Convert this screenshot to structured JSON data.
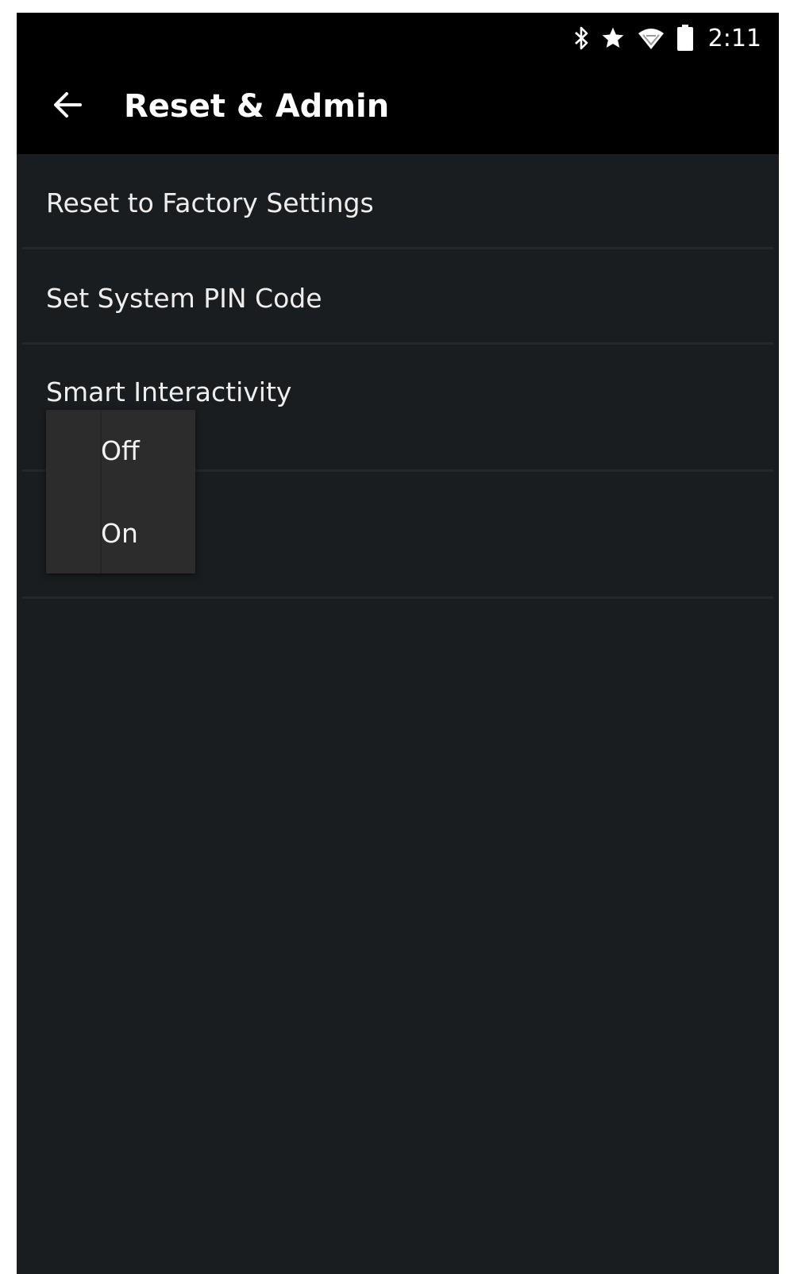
{
  "status_bar": {
    "time": "2:11",
    "icons": [
      "bluetooth-icon",
      "star-icon",
      "wifi-icon",
      "battery-icon"
    ]
  },
  "app_bar": {
    "title": "Reset & Admin",
    "back_icon": "back-arrow-icon"
  },
  "menu": {
    "items": [
      {
        "label": "Reset to Factory Settings"
      },
      {
        "label": "Set System PIN Code"
      },
      {
        "label": "Smart Interactivity"
      },
      {
        "label": ""
      }
    ]
  },
  "dropdown": {
    "options": [
      {
        "label": "Off"
      },
      {
        "label": "On"
      }
    ]
  },
  "colors": {
    "background": "#1a1d20",
    "app_bar": "#000000",
    "dropdown": "#2c2c2c",
    "text": "#eeeeee"
  }
}
